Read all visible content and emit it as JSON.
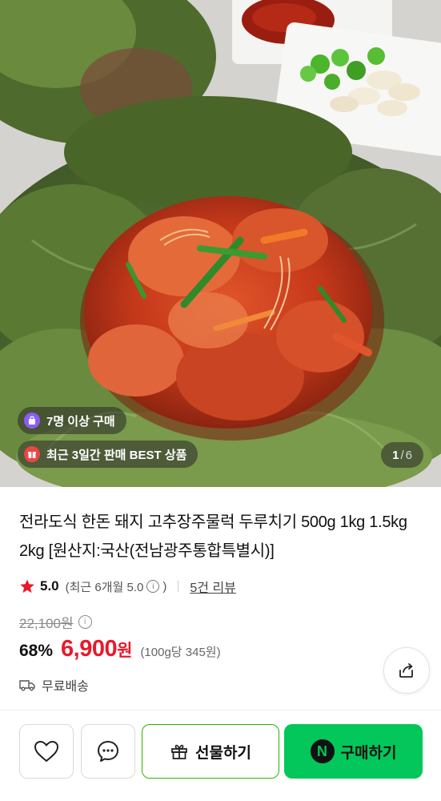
{
  "hero": {
    "badges": [
      {
        "label": "7명 이상 구매",
        "icon": "shopping-bag-icon"
      },
      {
        "label": "최근 3일간 판매 BEST 상품",
        "icon": "gift-box-icon"
      }
    ],
    "counter": {
      "current": "1",
      "separator": "/",
      "total": "6"
    }
  },
  "product": {
    "title": "전라도식 한돈 돼지 고추장주물럭 두루치기 500g 1kg 1.5kg 2kg [원산지:국산(전남광주통합특별시)]",
    "rating": {
      "score": "5.0",
      "recent_prefix": "(최근 6개월 5.0",
      "recent_suffix": ")",
      "reviews": "5건 리뷰"
    },
    "original_price": "22,100원",
    "discount": "68%",
    "sale_price": "6,900",
    "sale_unit": "원",
    "unit_price": "(100g당 345원)",
    "shipping": "무료배송"
  },
  "actions": {
    "gift_label": "선물하기",
    "buy_label": "구매하기",
    "buy_badge": "N"
  },
  "colors": {
    "accent_green": "#03c75a",
    "sale_red": "#e8192c",
    "star_red": "#e8192c"
  }
}
